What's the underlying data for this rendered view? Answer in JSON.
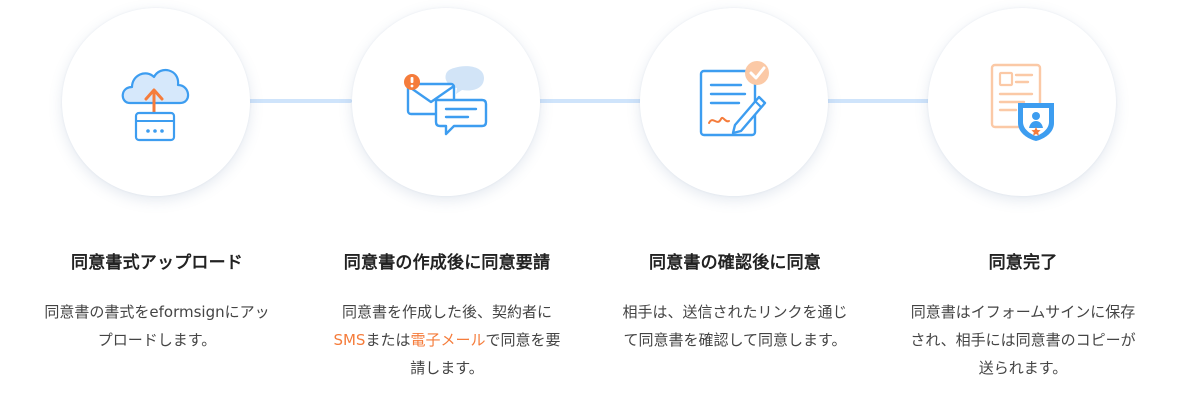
{
  "steps": [
    {
      "icon": "cloud-upload-icon",
      "title": "同意書式アップロード",
      "description": "同意書の書式をeformsignにアップロードします。"
    },
    {
      "icon": "email-sms-icon",
      "title": "同意書の作成後に同意要請",
      "description_pre": "同意書を作成した後、契約者に",
      "highlight_sms": "SMS",
      "description_mid": "または",
      "highlight_email": "電子メール",
      "description_post": "で同意を要請します。"
    },
    {
      "icon": "document-sign-icon",
      "title": "同意書の確認後に同意",
      "description": "相手は、送信されたリンクを通じて同意書を確認して同意します。"
    },
    {
      "icon": "document-certificate-icon",
      "title": "同意完了",
      "description": "同意書はイフォームサインに保存され、相手には同意書のコピーが送られます。"
    }
  ],
  "colors": {
    "blue": "#3d9df0",
    "light_blue": "#cfe4fb",
    "orange": "#f57c3b",
    "light_orange": "#fbc9a6"
  }
}
